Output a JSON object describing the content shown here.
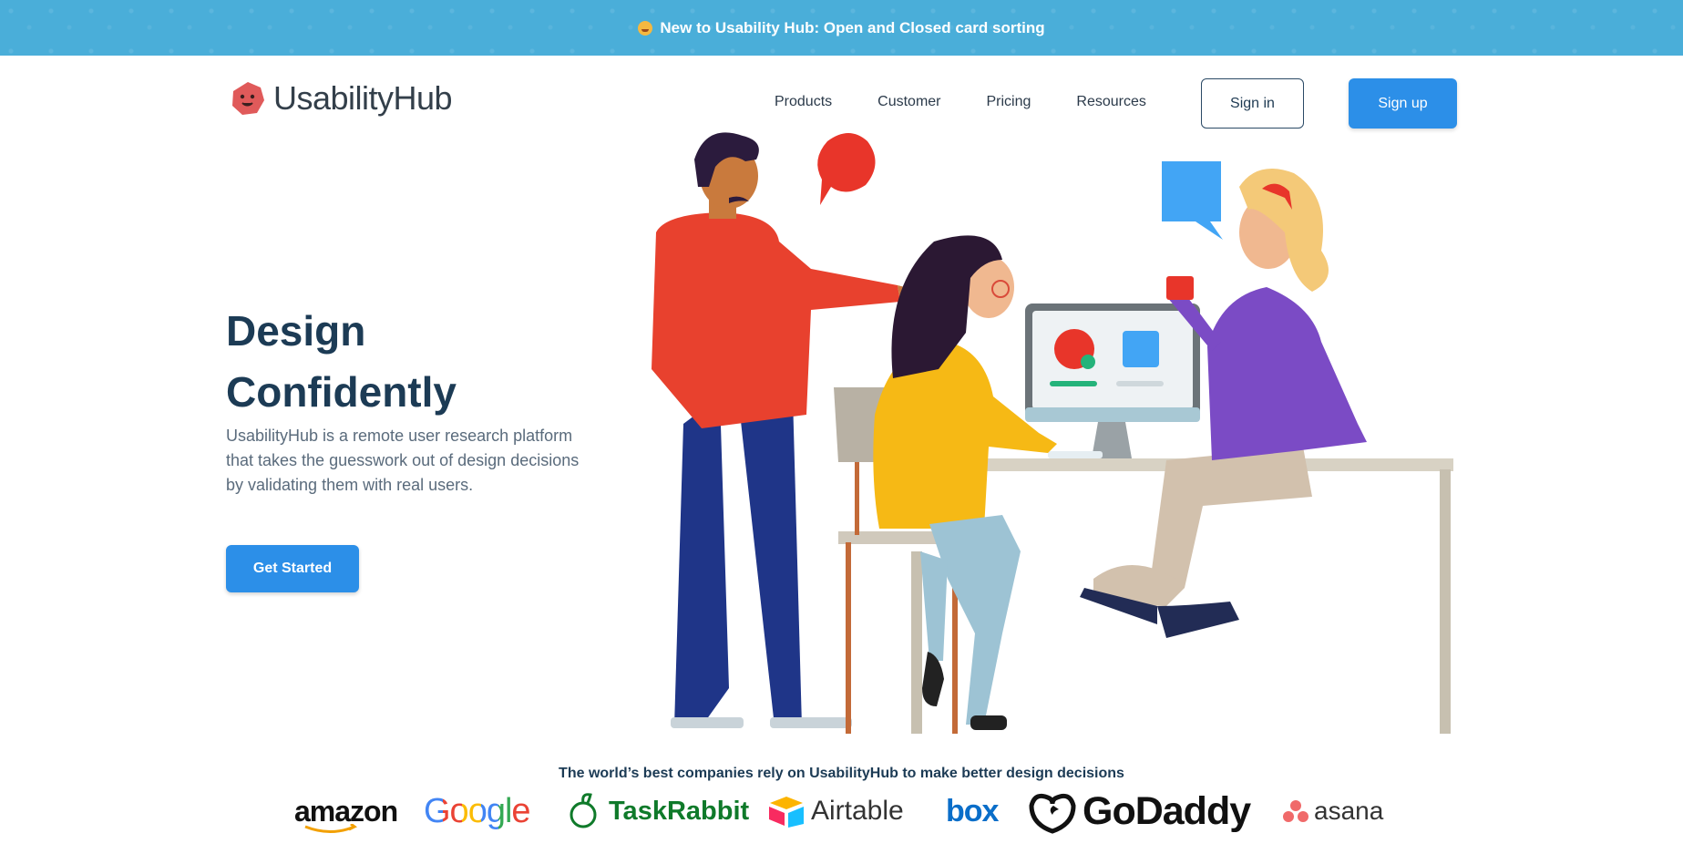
{
  "banner": {
    "text": "New to Usability Hub: Open and Closed card sorting"
  },
  "nav": {
    "logo_text": "UsabilityHub",
    "links": [
      "Products",
      "Customer",
      "Pricing",
      "Resources"
    ],
    "signin_label": "Sign in",
    "signup_label": "Sign up"
  },
  "hero": {
    "title_line1": "Design",
    "title_line2": "Confidently",
    "description": "UsabilityHub is a remote user research platform that takes the guesswork out of design decisions by validating them with real users.",
    "cta_label": "Get Started"
  },
  "trust": {
    "text": "The world’s best companies rely on UsabilityHub to make better design decisions",
    "brands": {
      "amazon": "amazon",
      "google": "Google",
      "taskrabbit": "TaskRabbit",
      "airtable": "Airtable",
      "box": "box",
      "godaddy": "GoDaddy",
      "asana": "asana"
    }
  },
  "colors": {
    "banner_bg": "#4aaed9",
    "primary_button": "#2c8fe8",
    "heading": "#1c3b55",
    "body_text": "#5a6b7c"
  },
  "icons": [
    "banner-emoji-icon",
    "usabilityhub-logo-icon",
    "taskrabbit-logo-icon",
    "airtable-logo-icon",
    "godaddy-logo-icon",
    "asana-logo-icon",
    "amazon-smile-icon"
  ]
}
